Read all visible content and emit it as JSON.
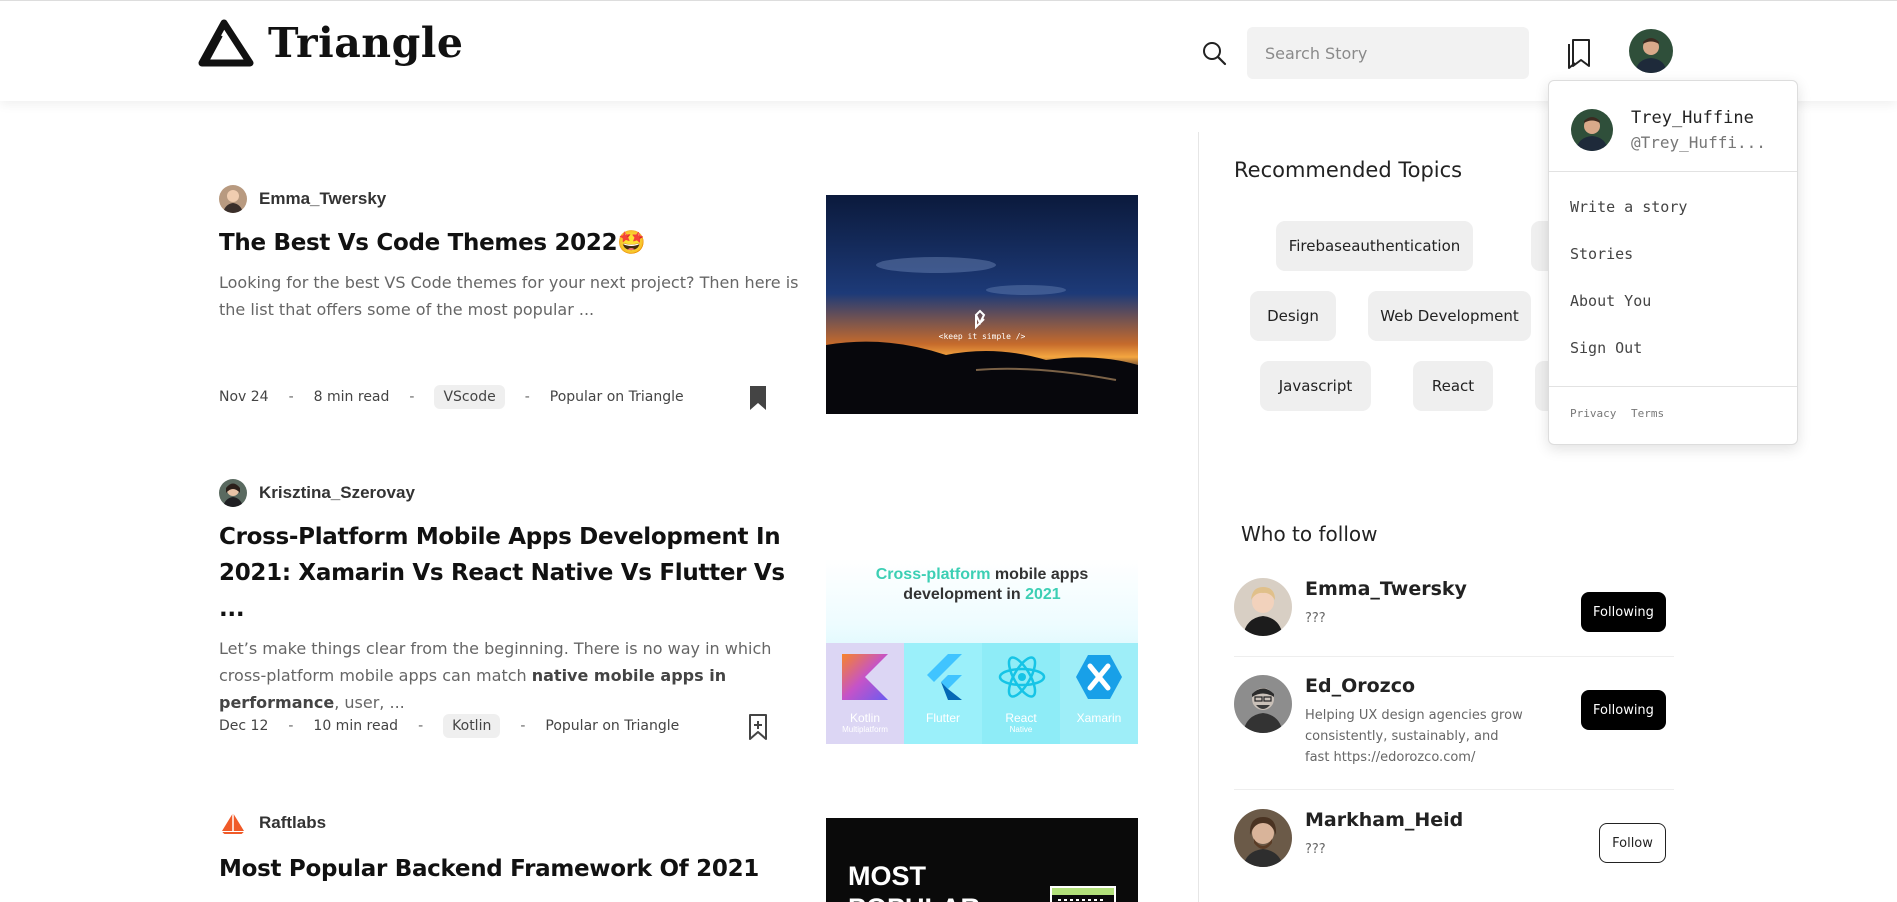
{
  "header": {
    "logo_text": "Triangle",
    "search_placeholder": "Search Story"
  },
  "articles": [
    {
      "author": "Emma_Twersky",
      "title": "The Best Vs Code Themes 2022🤩",
      "excerpt": "Looking for the best VS Code themes for your next project? Then here is the list that offers some of the most popular ...",
      "date": "Nov 24",
      "read_time": "8 min read",
      "tag": "VScode",
      "popular": "Popular on Triangle",
      "bookmarked": true,
      "thumb_caption": "<keep it simple />"
    },
    {
      "author": "Krisztina_Szerovay",
      "title": "Cross-Platform Mobile Apps Development In 2021: Xamarin Vs React Native Vs Flutter Vs ...",
      "excerpt_start": "Let’s make things clear from the beginning. There is no way in which cross-platform mobile apps can match ",
      "excerpt_bold": "native mobile apps in performance",
      "excerpt_end": ", user, ...",
      "date": "Dec 12",
      "read_time": "10 min read",
      "tag": "Kotlin",
      "popular": "Popular on Triangle",
      "bookmarked": false,
      "thumb": {
        "heading_accent": "Cross-platform",
        "heading_rest": " mobile apps",
        "heading_line2": "development in ",
        "heading_year": "2021",
        "platforms": [
          {
            "name": "Kotlin",
            "sub": "Multiplatform"
          },
          {
            "name": "Flutter",
            "sub": ""
          },
          {
            "name": "React",
            "sub": "Native"
          },
          {
            "name": "Xamarin",
            "sub": ""
          }
        ]
      }
    },
    {
      "author": "Raftlabs",
      "title": "Most Popular Backend Framework Of 2021",
      "thumb_text_1": "MOST",
      "thumb_text_2": "POPULAR"
    }
  ],
  "sidebar": {
    "topics_title": "Recommended Topics",
    "topics": [
      "Firebaseauthentication",
      "Design",
      "Web Development",
      "Javascript",
      "React"
    ],
    "follow_title": "Who to follow",
    "follow": [
      {
        "name": "Emma_Twersky",
        "bio": "???",
        "button": "Following"
      },
      {
        "name": "Ed_Orozco",
        "bio": "Helping UX design agencies grow consistently, sustainably, and fast https://edorozco.com/",
        "button": "Following"
      },
      {
        "name": "Markham_Heid",
        "bio": "???",
        "button": "Follow"
      }
    ]
  },
  "dropdown": {
    "name": "Trey_Huffine",
    "handle": "@Trey_Huffi...",
    "items": [
      "Write a story",
      "Stories",
      "About You",
      "Sign Out"
    ],
    "footer": [
      "Privacy",
      "Terms"
    ]
  },
  "colors": {
    "accent_teal": "#3ccfb4",
    "button_black": "#000000",
    "chip_bg": "#efefef"
  }
}
